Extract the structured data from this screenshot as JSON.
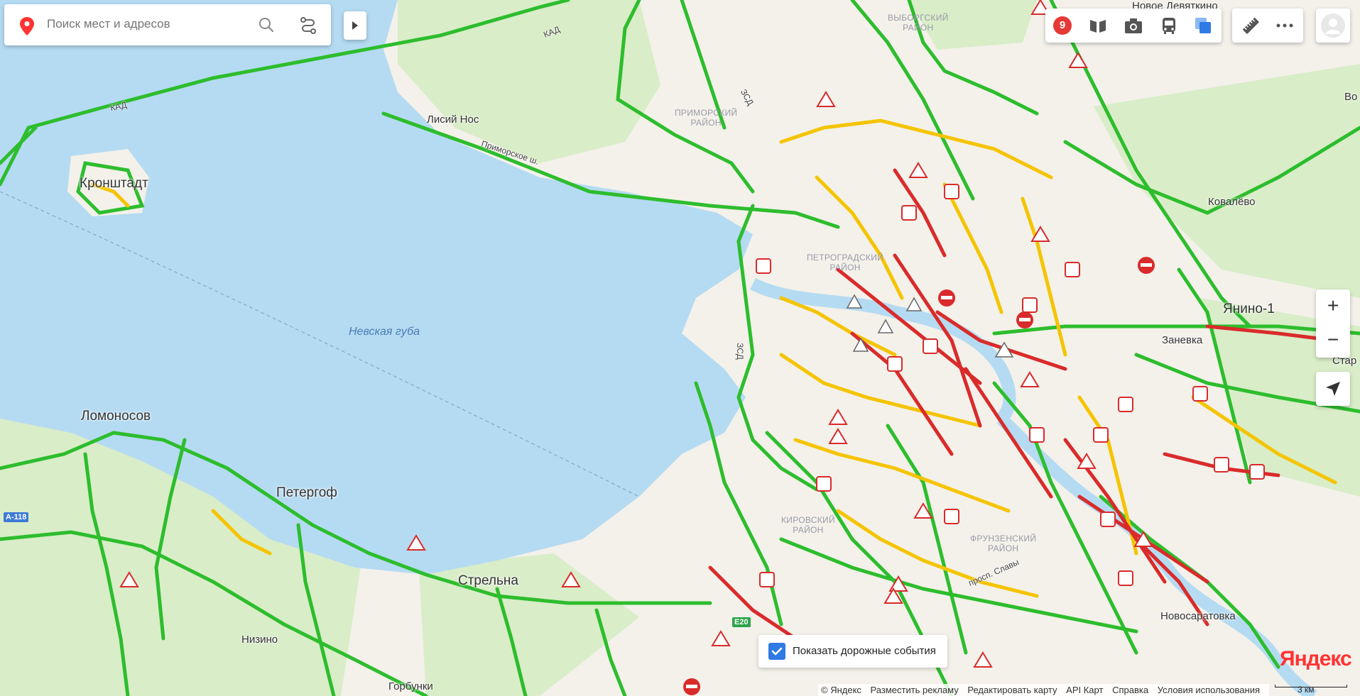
{
  "search": {
    "placeholder": "Поиск мест и адресов"
  },
  "toolbar": {
    "traffic_score": "9",
    "icons": [
      "traffic-icon",
      "panorama-icon",
      "photo-icon",
      "transit-icon",
      "layers-icon"
    ],
    "extra_icons": [
      "ruler-icon",
      "more-icon"
    ]
  },
  "zoom": {
    "plus": "+",
    "minus": "−"
  },
  "events_toggle": {
    "label": "Показать дорожные события",
    "checked": true
  },
  "footer": {
    "links": [
      "© Яндекс",
      "Разместить рекламу",
      "Редактировать карту",
      "API Карт",
      "Справка",
      "Условия использования"
    ]
  },
  "scale": {
    "label": "3 км"
  },
  "brand": {
    "logo": "Яндекс"
  },
  "map": {
    "cities": [
      "Кронштадт",
      "Ломоносов",
      "Петергоф",
      "Стрельна",
      "Янино-1"
    ],
    "towns": [
      "Лисий Нос",
      "Низино",
      "Горбунки",
      "Ковалёво",
      "Заневка",
      "Новосаратовка",
      "Новое Девяткино",
      "Во",
      "Стар"
    ],
    "districts": [
      "ПРИМОРСКИЙ\nРАЙОН",
      "ВЫБОРГСКИЙ\nРАЙОН",
      "ПЕТРОГРАДСКИЙ\nРАЙОН",
      "КИРОВСКИЙ\nРАЙОН",
      "ФРУНЗЕНСКИЙ\nРАЙОН"
    ],
    "water": "Невская губа",
    "roads": [
      "КАД",
      "ЗСД",
      "Приморское ш.",
      "просп. Славы"
    ],
    "highways": [
      "А-118",
      "E20"
    ]
  },
  "colors": {
    "water": "#b5dbf2",
    "land": "#f3f1ea",
    "green_area": "#d9edc8",
    "traffic_free": "#2dbd2d",
    "traffic_slow": "#f5c400",
    "traffic_jam": "#d92b2b",
    "accent": "#2f7ae5"
  }
}
